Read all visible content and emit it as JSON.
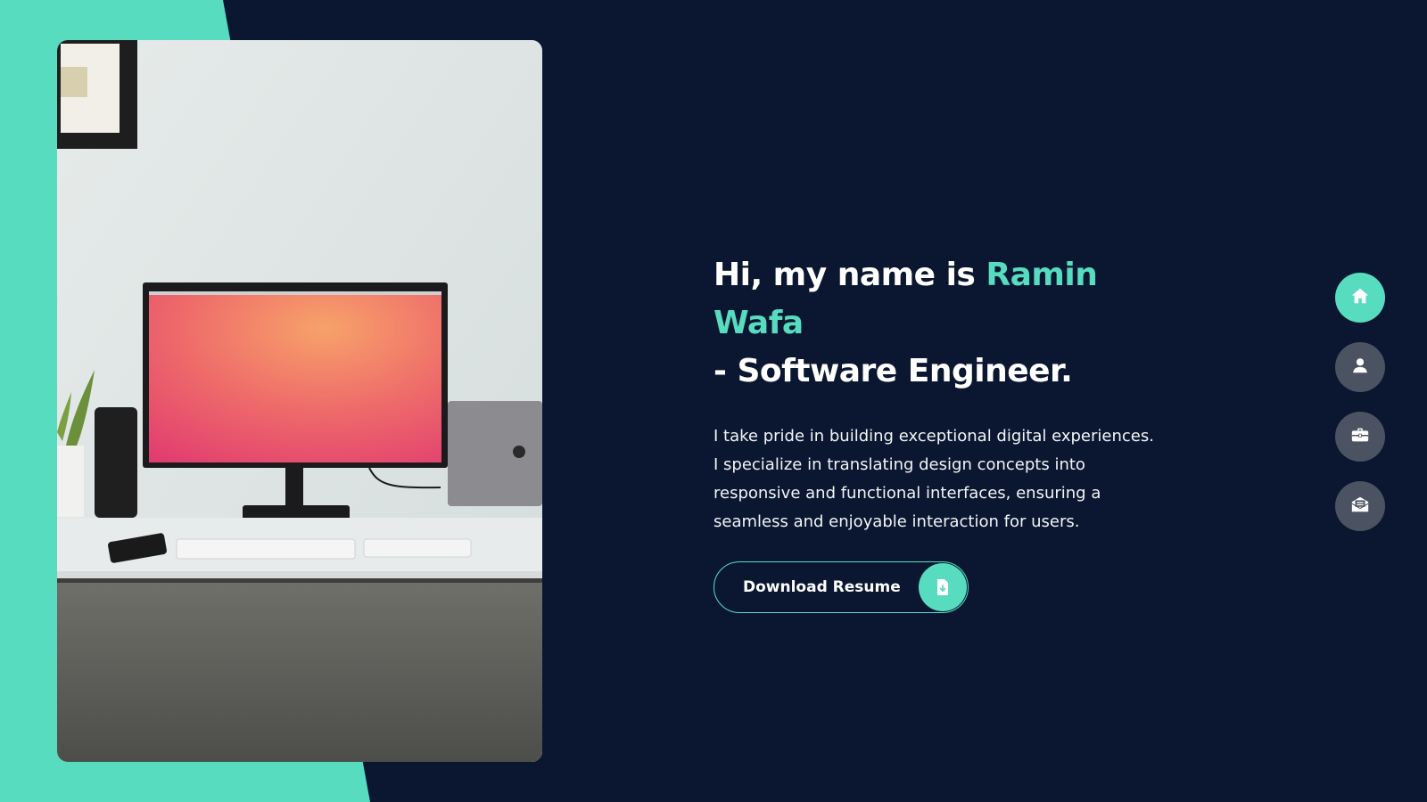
{
  "hero": {
    "greeting": "Hi, my name is ",
    "name": "Ramin Wafa",
    "role": "- Software Engineer.",
    "bio": "I take pride in building exceptional digital experiences. I specialize in translating design concepts into responsive and functional interfaces, ensuring a seamless and enjoyable interaction for users.",
    "download_label": "Download Resume"
  },
  "side_nav": [
    {
      "icon": "home-icon",
      "active": true
    },
    {
      "icon": "user-icon",
      "active": false
    },
    {
      "icon": "briefcase-icon",
      "active": false
    },
    {
      "icon": "mail-icon",
      "active": false
    }
  ],
  "colors": {
    "background": "#0b1730",
    "accent": "#58dcc0",
    "nav_inactive": "#4b5363"
  }
}
